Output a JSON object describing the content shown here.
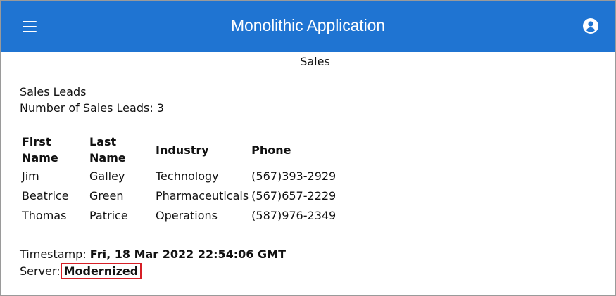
{
  "app": {
    "title": "Monolithic Application",
    "brand_color": "#1f74d2",
    "menu_icon": "menu-icon",
    "account_icon": "account-circle-icon"
  },
  "page": {
    "title": "Sales"
  },
  "sales": {
    "section_label": "Sales Leads",
    "count_label": "Number of Sales Leads: 3",
    "table": {
      "headers": [
        "First Name",
        "Last Name",
        "Industry",
        "Phone"
      ],
      "rows": [
        [
          "Jim",
          "Galley",
          "Technology",
          "(567)393-2929"
        ],
        [
          "Beatrice",
          "Green",
          "Pharmaceuticals",
          "(567)657-2229"
        ],
        [
          "Thomas",
          "Patrice",
          "Operations",
          "(587)976-2349"
        ]
      ]
    }
  },
  "meta": {
    "timestamp_label": "Timestamp:",
    "timestamp_value": "Fri, 18 Mar 2022 22:54:06 GMT",
    "server_label": "Server:",
    "server_value": "Modernized",
    "highlight_color": "#d61f26"
  }
}
